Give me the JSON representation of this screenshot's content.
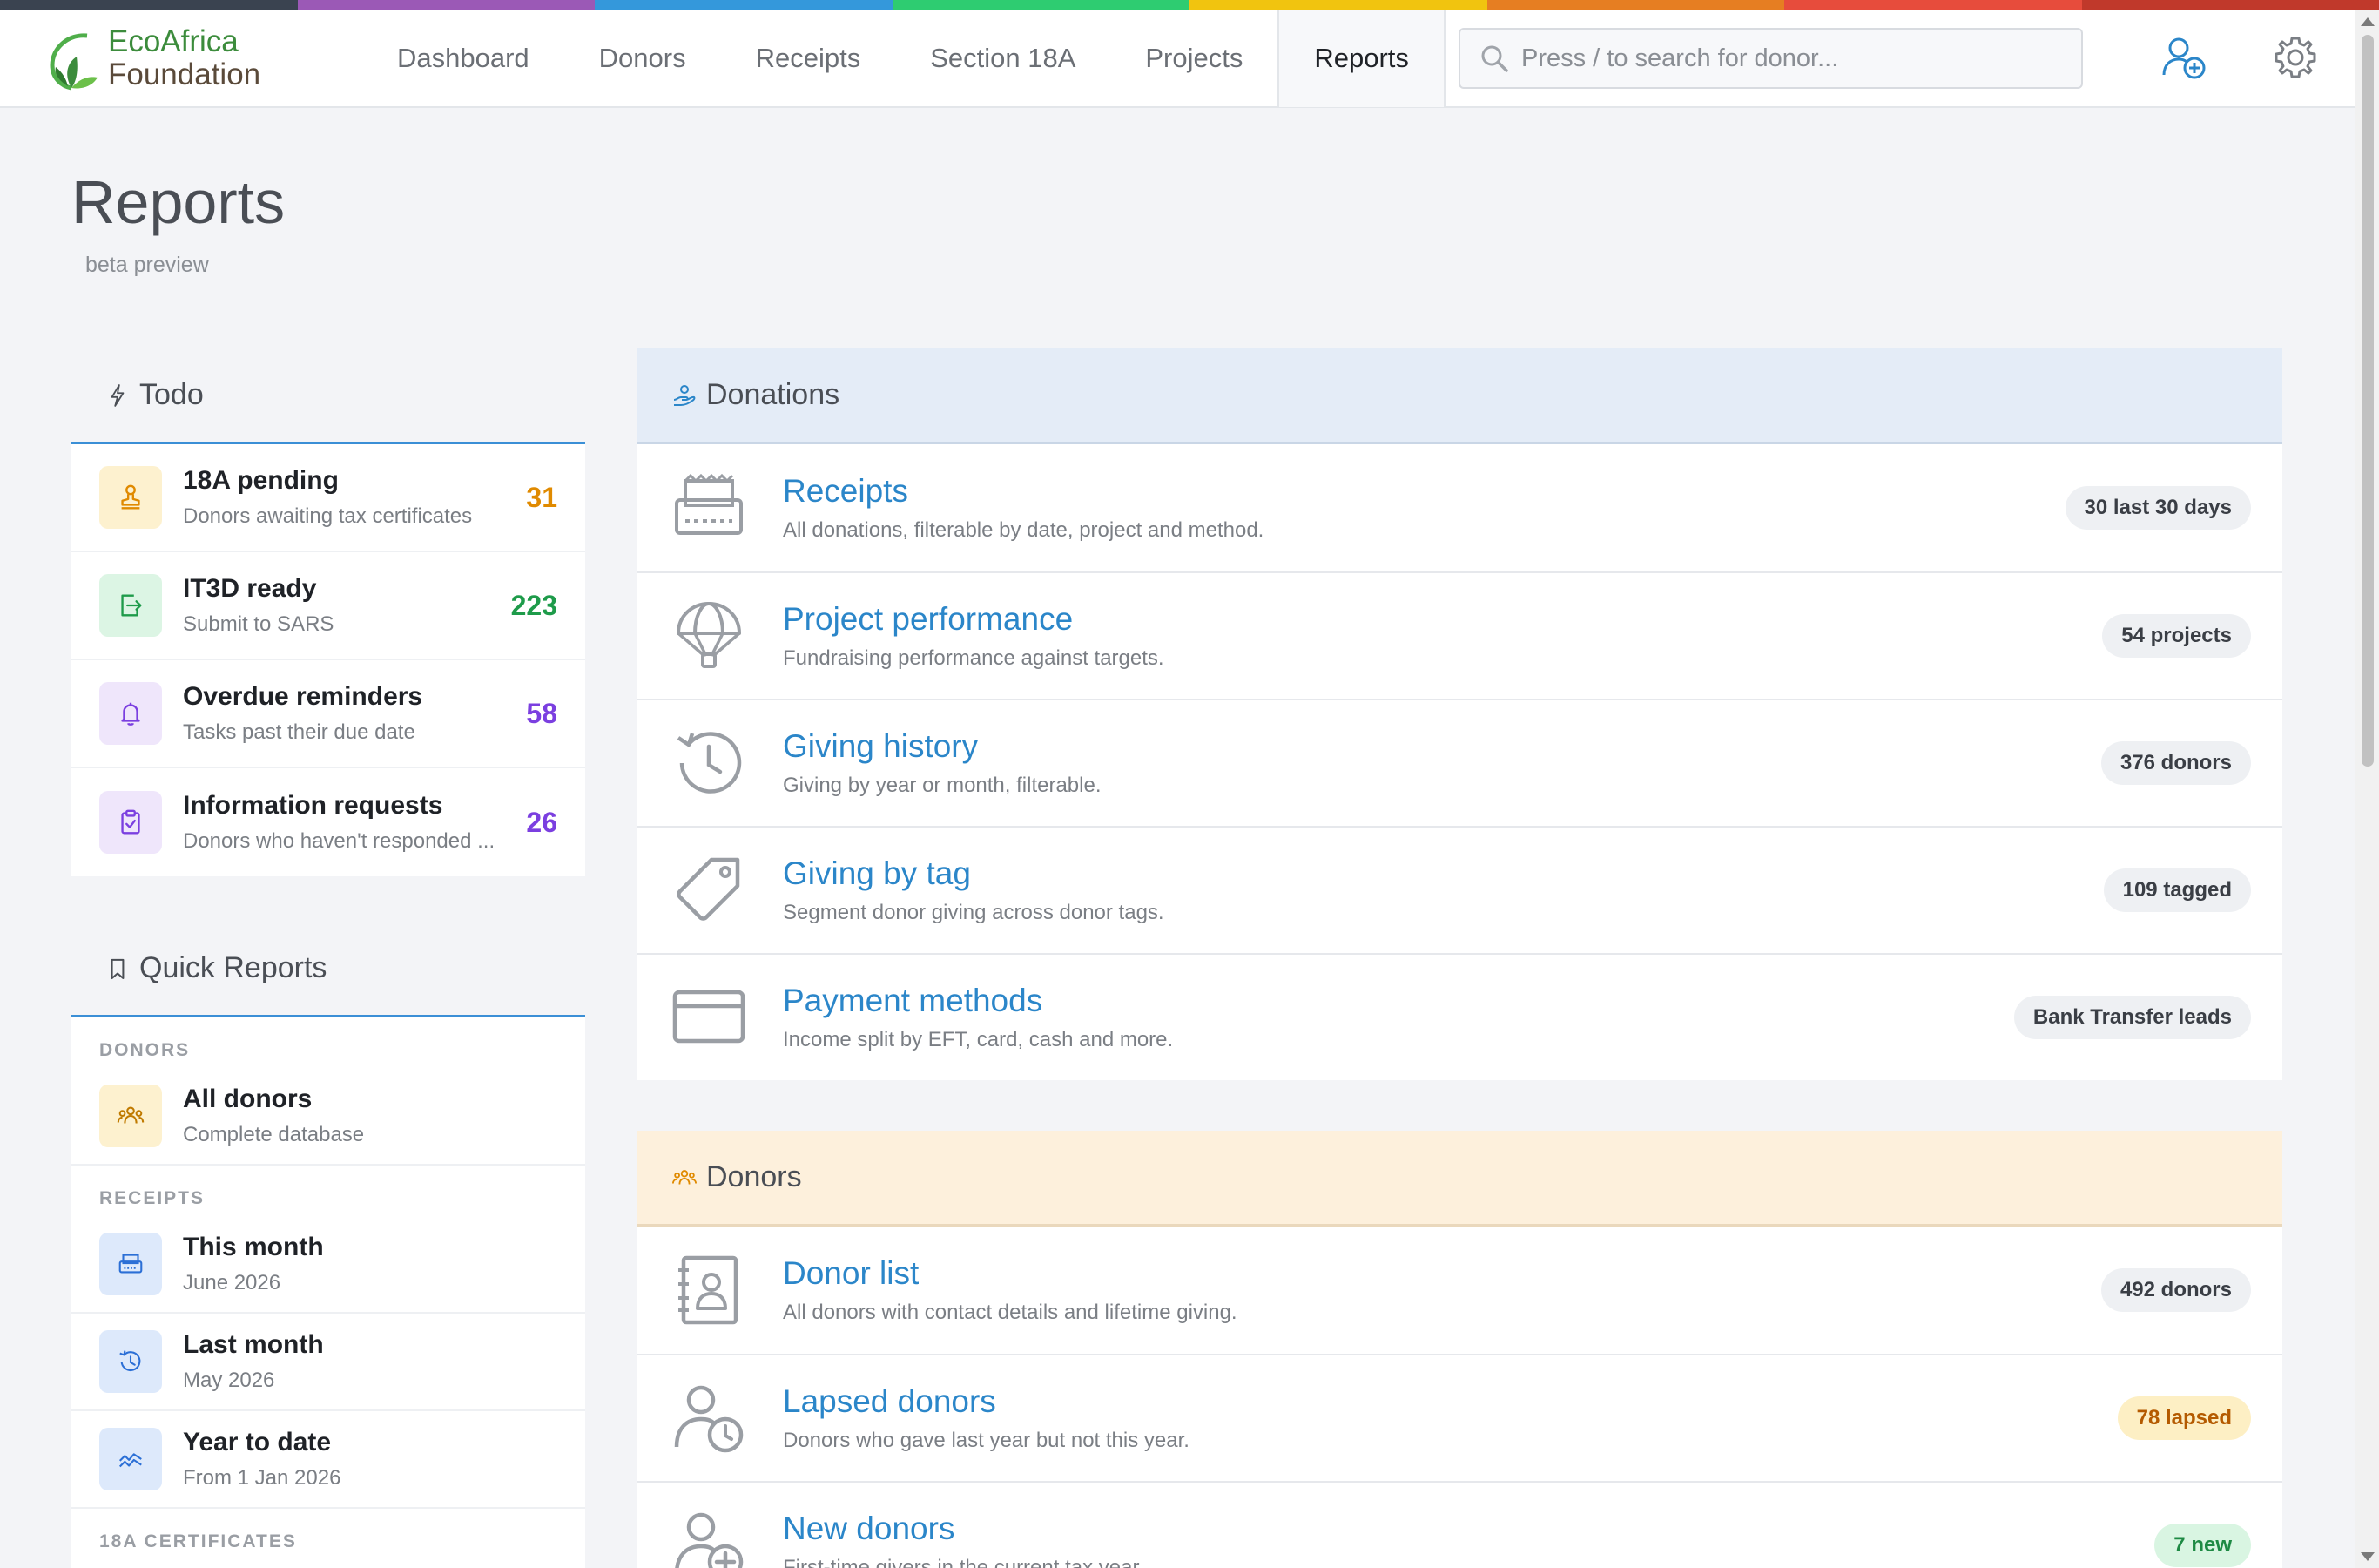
{
  "colors": {
    "stripe": [
      "#3a4350",
      "#9b59b6",
      "#3498db",
      "#2ecc71",
      "#f1c40f",
      "#e67e22",
      "#e74c3c",
      "#c0392b"
    ],
    "accent": "#3b8fd6",
    "link": "#2b86c9"
  },
  "header": {
    "logo_line1": "EcoAfrica",
    "logo_line2": "Foundation",
    "nav": [
      {
        "label": "Dashboard"
      },
      {
        "label": "Donors"
      },
      {
        "label": "Receipts"
      },
      {
        "label": "Section 18A"
      },
      {
        "label": "Projects"
      },
      {
        "label": "Reports",
        "active": true
      }
    ],
    "search_placeholder": "Press / to search for donor...",
    "icons": [
      "add-donor-icon",
      "gear-icon"
    ]
  },
  "page": {
    "title": "Reports",
    "subtitle": "beta preview"
  },
  "todo": {
    "heading": "Todo",
    "items": [
      {
        "title": "18A pending",
        "desc": "Donors awaiting tax certificates",
        "count": "31",
        "icon": "stamp-icon",
        "color": "#e08a00",
        "bg": "#fdf1cf"
      },
      {
        "title": "IT3D ready",
        "desc": "Submit to SARS",
        "count": "223",
        "icon": "export-icon",
        "color": "#1e9b4a",
        "bg": "#dcf5e4"
      },
      {
        "title": "Overdue reminders",
        "desc": "Tasks past their due date",
        "count": "58",
        "icon": "bell-icon",
        "color": "#7b3fe0",
        "bg": "#efe6fb"
      },
      {
        "title": "Information requests",
        "desc": "Donors who haven't responded ...",
        "count": "26",
        "icon": "clipboard-check-icon",
        "color": "#7b3fe0",
        "bg": "#efe6fb"
      }
    ]
  },
  "quick_reports": {
    "heading": "Quick Reports",
    "sections": [
      {
        "label": "DONORS",
        "items": [
          {
            "title": "All donors",
            "desc": "Complete database",
            "icon": "people-icon",
            "bg": "#fdf1cf",
            "color": "#c07a00"
          }
        ]
      },
      {
        "label": "RECEIPTS",
        "items": [
          {
            "title": "This month",
            "desc": "June 2026",
            "icon": "receipt-printer-icon",
            "bg": "#dde9fb",
            "color": "#2b6fd6"
          },
          {
            "title": "Last month",
            "desc": "May 2026",
            "icon": "history-icon",
            "bg": "#dde9fb",
            "color": "#2b6fd6"
          },
          {
            "title": "Year to date",
            "desc": "From 1 Jan 2026",
            "icon": "trend-icon",
            "bg": "#dde9fb",
            "color": "#2b6fd6"
          }
        ]
      },
      {
        "label": "18A CERTIFICATES",
        "items": []
      }
    ]
  },
  "donations": {
    "heading": "Donations",
    "bg": "#e4ecf7",
    "rows": [
      {
        "title": "Receipts",
        "desc": "All donations, filterable by date, project and method.",
        "badge": "30 last 30 days",
        "icon": "receipt-printer-icon"
      },
      {
        "title": "Project performance",
        "desc": "Fundraising performance against targets.",
        "badge": "54 projects",
        "icon": "parachute-icon"
      },
      {
        "title": "Giving history",
        "desc": "Giving by year or month, filterable.",
        "badge": "376 donors",
        "icon": "history-icon"
      },
      {
        "title": "Giving by tag",
        "desc": "Segment donor giving across donor tags.",
        "badge": "109 tagged",
        "icon": "tag-icon"
      },
      {
        "title": "Payment methods",
        "desc": "Income split by EFT, card, cash and more.",
        "badge": "Bank Transfer leads",
        "icon": "credit-card-icon"
      }
    ]
  },
  "donors": {
    "heading": "Donors",
    "bg": "#fdf0dc",
    "rows": [
      {
        "title": "Donor list",
        "desc": "All donors with contact details and lifetime giving.",
        "badge": "492 donors",
        "icon": "contact-book-icon"
      },
      {
        "title": "Lapsed donors",
        "desc": "Donors who gave last year but not this year.",
        "badge": "78 lapsed",
        "icon": "user-clock-icon",
        "badge_bg": "#fdefc4",
        "badge_color": "#b45a00"
      },
      {
        "title": "New donors",
        "desc": "First-time givers in the current tax year.",
        "badge": "7 new",
        "icon": "user-plus-icon",
        "badge_bg": "#d9f5e2",
        "badge_color": "#1e8a44"
      }
    ]
  }
}
